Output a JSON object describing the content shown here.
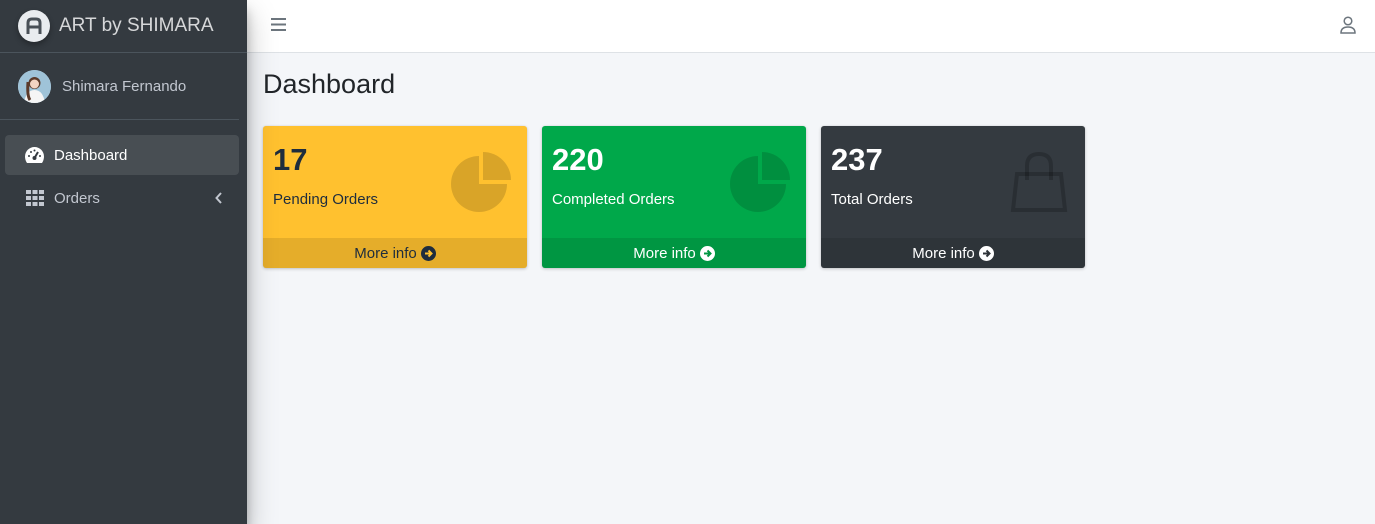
{
  "brand": {
    "name": "ART by SHIMARA",
    "logo_icon": "brand-logo-icon"
  },
  "user": {
    "name": "Shimara Fernando"
  },
  "sidebar": {
    "items": [
      {
        "label": "Dashboard",
        "icon": "tachometer-icon",
        "active": true
      },
      {
        "label": "Orders",
        "icon": "grid-icon",
        "active": false
      }
    ]
  },
  "page": {
    "title": "Dashboard"
  },
  "boxes": [
    {
      "value": "17",
      "label": "Pending Orders",
      "footer": "More info",
      "icon": "pie-chart-icon",
      "color": "#ffc12f"
    },
    {
      "value": "220",
      "label": "Completed Orders",
      "footer": "More info",
      "icon": "pie-chart-icon",
      "color": "#00a84a"
    },
    {
      "value": "237",
      "label": "Total Orders",
      "footer": "More info",
      "icon": "shopping-bag-icon",
      "color": "#343a40"
    }
  ]
}
